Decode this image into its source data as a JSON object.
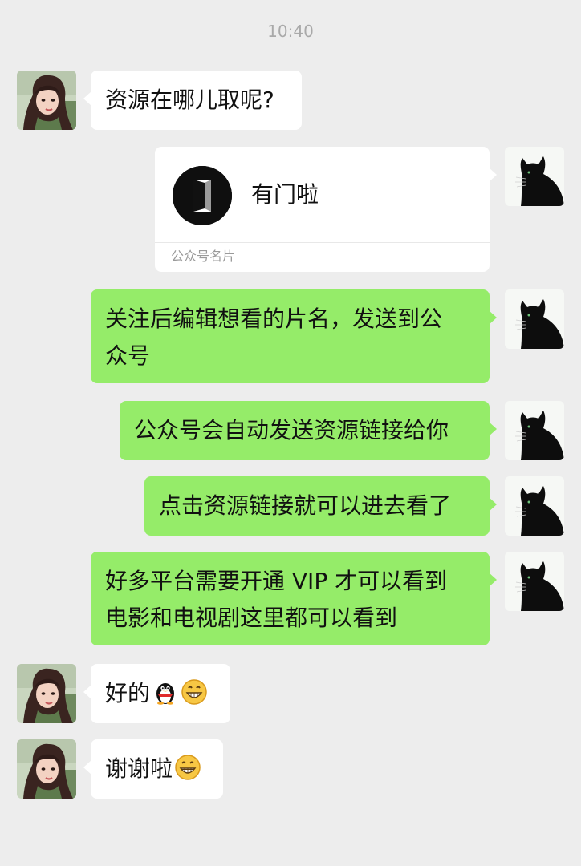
{
  "timestamp": "10:40",
  "contact_card": {
    "name": "有门啦",
    "footer_label": "公众号名片",
    "logo_icon": "door-logo-icon"
  },
  "messages": [
    {
      "sender": "other",
      "text": "资源在哪儿取呢?"
    },
    {
      "sender": "self",
      "text_line1": "关注后编辑想看的片名，发送到公",
      "text_line2": "众号"
    },
    {
      "sender": "self",
      "text": "公众号会自动发送资源链接给你"
    },
    {
      "sender": "self",
      "text": "点击资源链接就可以进去看了"
    },
    {
      "sender": "self",
      "text_line1": "好多平台需要开通 VIP 才可以看到",
      "text_line2": "电影和电视剧这里都可以看到"
    },
    {
      "sender": "other",
      "text": "好的",
      "emojis": [
        "penguin-emoji-icon",
        "grin-emoji-icon"
      ]
    },
    {
      "sender": "other",
      "text": "谢谢啦",
      "emojis": [
        "grin-emoji-icon"
      ]
    }
  ],
  "colors": {
    "background": "#ededed",
    "self_bubble": "#95ec69",
    "other_bubble": "#ffffff",
    "timestamp": "#a9a9a9"
  },
  "avatars": {
    "self": "black-cat-avatar",
    "other": "girl-portrait-avatar"
  }
}
